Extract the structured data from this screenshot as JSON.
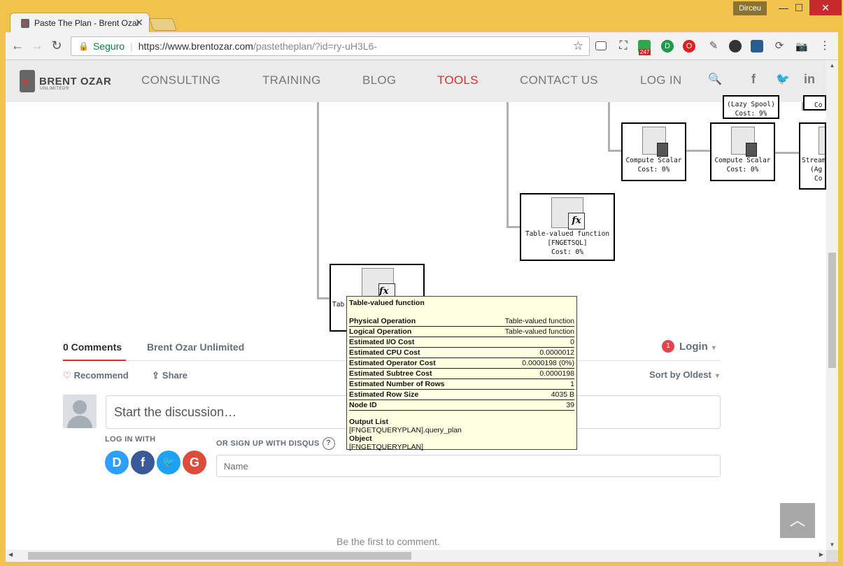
{
  "browser": {
    "tab_title": "Paste The Plan - Brent Ozar",
    "tab_close": "✕",
    "user_name": "Dirceu",
    "win_minimize": "—",
    "win_maximize": "☐",
    "win_close": "✕",
    "secure_label": "Seguro",
    "url_host": "https://www.brentozar.com",
    "url_path": "/pastetheplan/?id=ry-uH3L6-",
    "ext_badge": "247",
    "ext_d": "D",
    "ext_o": "O"
  },
  "site_nav": {
    "brand": "BRENT OZAR",
    "brand_sub": "UNLIMITED®",
    "links": [
      "CONSULTING",
      "TRAINING",
      "BLOG",
      "TOOLS",
      "CONTACT US",
      "LOG IN"
    ],
    "active_link": "TOOLS",
    "social_icons": [
      "facebook-icon",
      "twitter-icon",
      "linkedin-icon"
    ],
    "facebook_glyph": "f",
    "twitter_glyph": "🐦",
    "linkedin_glyph": "in",
    "search_glyph": "🔍"
  },
  "plan": {
    "nodes": [
      {
        "name": "lazy-spool",
        "label1": "(Lazy Spool)",
        "label2": "Cost: 9%"
      },
      {
        "name": "partial-node",
        "label1": "Co"
      },
      {
        "name": "compute-scalar-1",
        "label1": "Compute Scalar",
        "label2": "Cost: 0%"
      },
      {
        "name": "compute-scalar-2",
        "label1": "Compute Scalar",
        "label2": "Cost: 0%"
      },
      {
        "name": "stream-aggregate",
        "label1": "Stream",
        "label2": "(Ag",
        "label3": "Co"
      },
      {
        "name": "tvf-fngetsql",
        "label1": "Table-valued function",
        "label2": "[FNGETSQL]",
        "label3": "Cost: 0%"
      },
      {
        "name": "tvf-fngetqueryplan",
        "label1": "Tab",
        "label2": "["
      }
    ],
    "fx_glyph": "fx"
  },
  "tooltip": {
    "title": "Table-valued function",
    "rows": [
      {
        "k": "Physical Operation",
        "v": "Table-valued function"
      },
      {
        "k": "Logical Operation",
        "v": "Table-valued function"
      },
      {
        "k": "Estimated I/O Cost",
        "v": "0"
      },
      {
        "k": "Estimated CPU Cost",
        "v": "0.0000012"
      },
      {
        "k": "Estimated Operator Cost",
        "v": "0.0000198 (0%)"
      },
      {
        "k": "Estimated Subtree Cost",
        "v": "0.0000198"
      },
      {
        "k": "Estimated Number of Rows",
        "v": "1"
      },
      {
        "k": "Estimated Row Size",
        "v": "4035 B"
      },
      {
        "k": "Node ID",
        "v": "39"
      }
    ],
    "output_list_label": "Output List",
    "output_list_value": "[FNGETQUERYPLAN].query_plan",
    "object_label": "Object",
    "object_value": "[FNGETQUERYPLAN]"
  },
  "comments": {
    "tab_comments": "0 Comments",
    "tab_site": "Brent Ozar Unlimited",
    "login_count": "1",
    "login_label": "Login",
    "caret": "▾",
    "recommend_icon": "♡",
    "recommend": "Recommend",
    "share_icon": "⇪",
    "share": "Share",
    "sort": "Sort by Oldest",
    "placeholder": "Start the discussion…",
    "log_in_with": "LOG IN WITH",
    "sign_up": "OR SIGN UP WITH DISQUS",
    "help_icon": "?",
    "disqus_glyph": "D",
    "facebook_glyph": "f",
    "twitter_glyph": "🐦",
    "google_glyph": "G",
    "name_placeholder": "Name",
    "empty": "Be the first to comment."
  },
  "scroll_top_glyph": "︿",
  "colors": {
    "accent_red": "#d9322e",
    "tooltip_bg": "#ffffe1",
    "disqus": "#2e9fff",
    "facebook": "#3b5998",
    "twitter": "#1da1f2",
    "google": "#dd4b39"
  }
}
